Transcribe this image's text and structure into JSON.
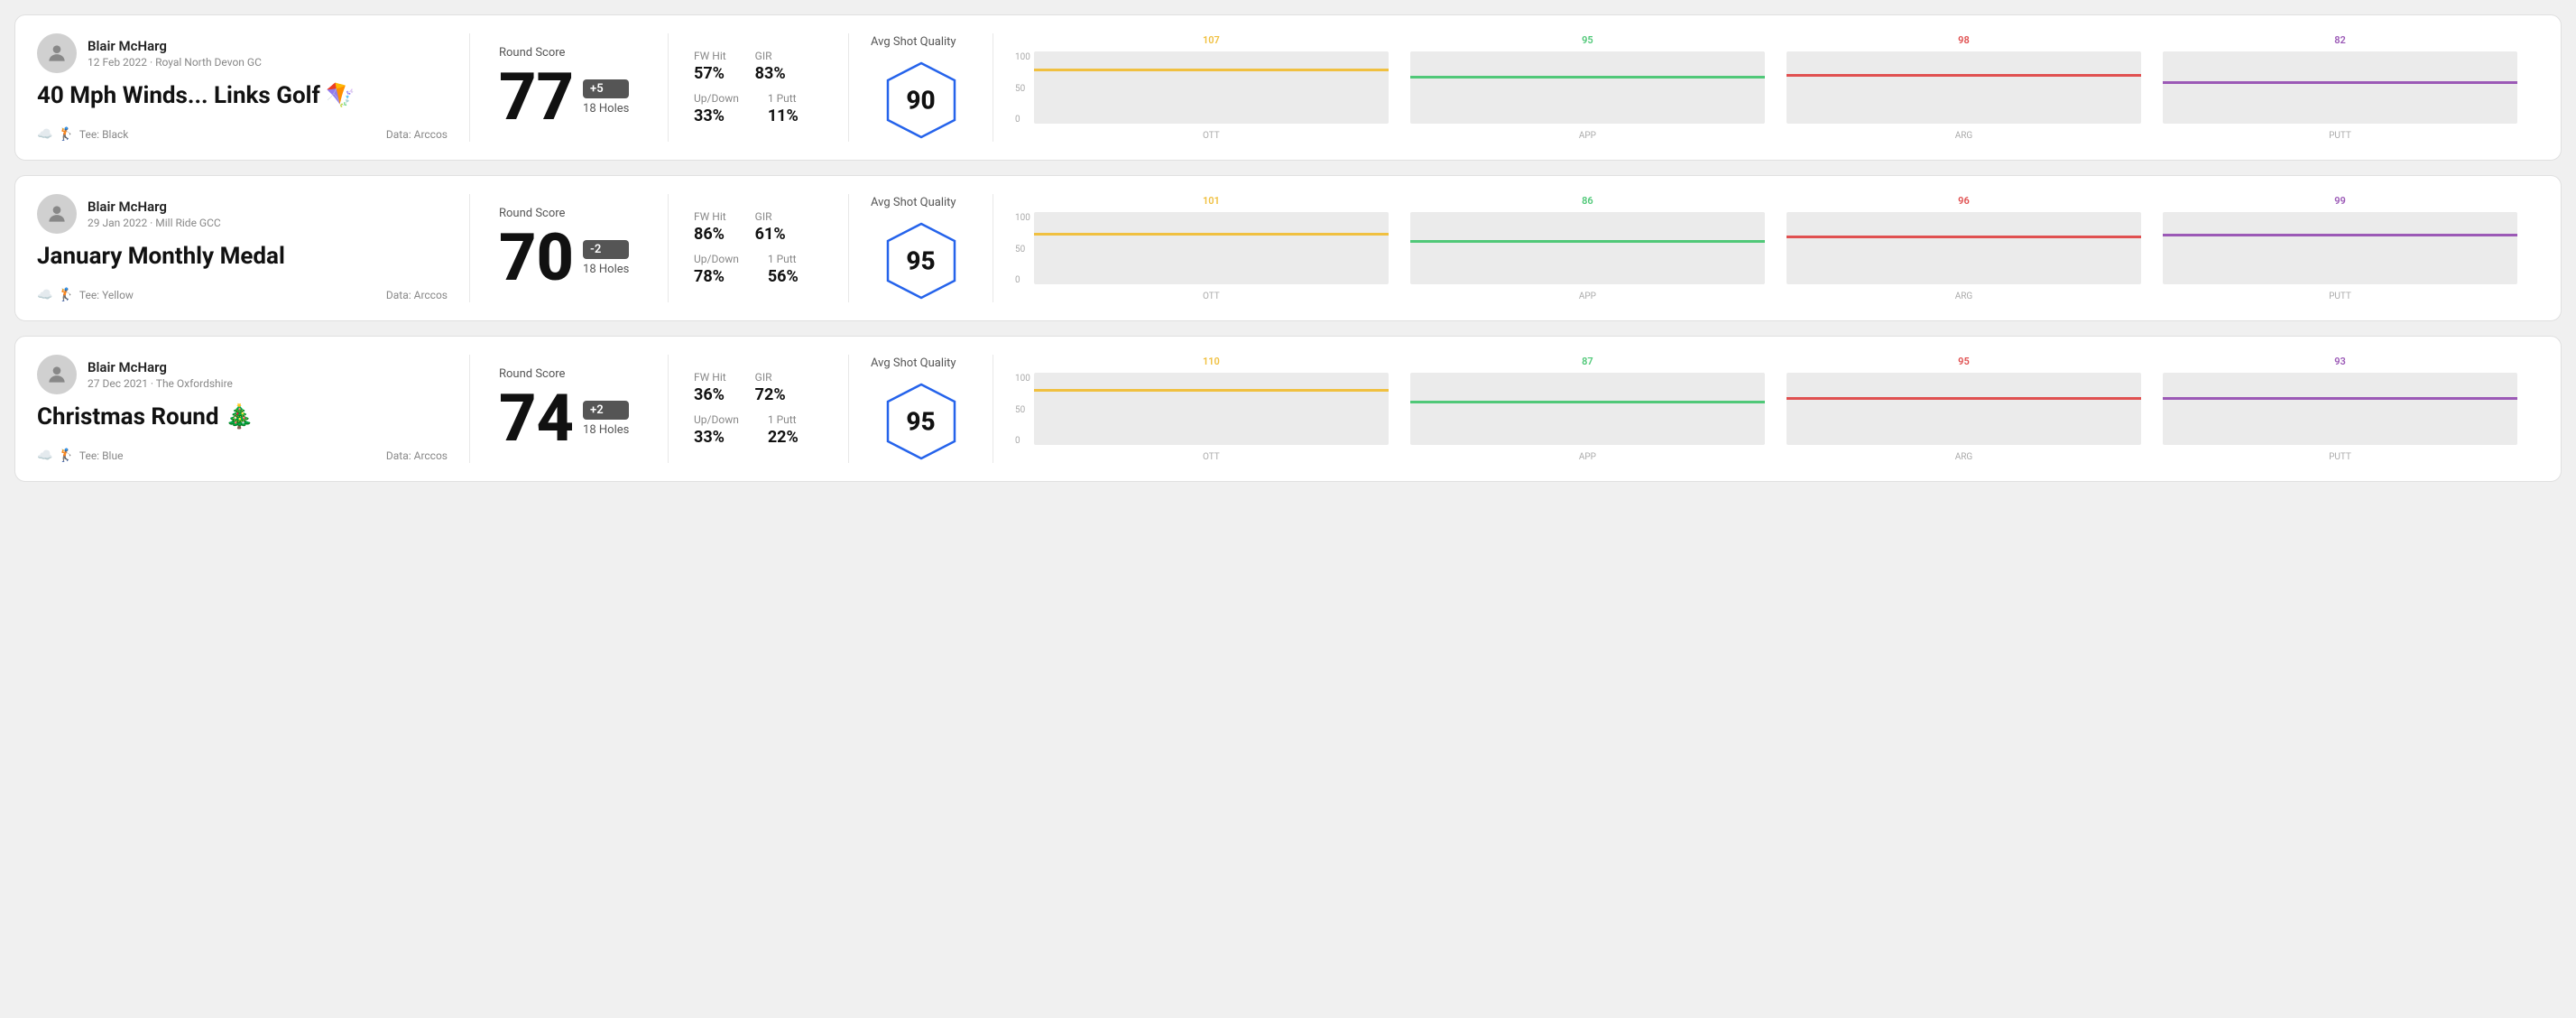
{
  "rounds": [
    {
      "id": "round1",
      "user": {
        "name": "Blair McHarg",
        "meta": "12 Feb 2022 · Royal North Devon GC"
      },
      "title": "40 Mph Winds... Links Golf 🪁",
      "tee": "Black",
      "data_source": "Arccos",
      "score": {
        "label": "Round Score",
        "number": "77",
        "modifier": "+5",
        "modifier_type": "plus",
        "holes": "18 Holes"
      },
      "stats": [
        {
          "label": "FW Hit",
          "value": "57%"
        },
        {
          "label": "GIR",
          "value": "83%"
        },
        {
          "label": "Up/Down",
          "value": "33%"
        },
        {
          "label": "1 Putt",
          "value": "11%"
        }
      ],
      "quality": {
        "label": "Avg Shot Quality",
        "score": "90"
      },
      "chart": {
        "bars": [
          {
            "label": "OTT",
            "top_value": "107",
            "color": "#f0c040",
            "fill_pct": 72
          },
          {
            "label": "APP",
            "top_value": "95",
            "color": "#50c878",
            "fill_pct": 62
          },
          {
            "label": "ARG",
            "top_value": "98",
            "color": "#e05050",
            "fill_pct": 65
          },
          {
            "label": "PUTT",
            "top_value": "82",
            "color": "#9b59b6",
            "fill_pct": 55
          }
        ]
      }
    },
    {
      "id": "round2",
      "user": {
        "name": "Blair McHarg",
        "meta": "29 Jan 2022 · Mill Ride GCC"
      },
      "title": "January Monthly Medal",
      "tee": "Yellow",
      "data_source": "Arccos",
      "score": {
        "label": "Round Score",
        "number": "70",
        "modifier": "-2",
        "modifier_type": "minus",
        "holes": "18 Holes"
      },
      "stats": [
        {
          "label": "FW Hit",
          "value": "86%"
        },
        {
          "label": "GIR",
          "value": "61%"
        },
        {
          "label": "Up/Down",
          "value": "78%"
        },
        {
          "label": "1 Putt",
          "value": "56%"
        }
      ],
      "quality": {
        "label": "Avg Shot Quality",
        "score": "95"
      },
      "chart": {
        "bars": [
          {
            "label": "OTT",
            "top_value": "101",
            "color": "#f0c040",
            "fill_pct": 68
          },
          {
            "label": "APP",
            "top_value": "86",
            "color": "#50c878",
            "fill_pct": 58
          },
          {
            "label": "ARG",
            "top_value": "96",
            "color": "#e05050",
            "fill_pct": 64
          },
          {
            "label": "PUTT",
            "top_value": "99",
            "color": "#9b59b6",
            "fill_pct": 66
          }
        ]
      }
    },
    {
      "id": "round3",
      "user": {
        "name": "Blair McHarg",
        "meta": "27 Dec 2021 · The Oxfordshire"
      },
      "title": "Christmas Round 🎄",
      "tee": "Blue",
      "data_source": "Arccos",
      "score": {
        "label": "Round Score",
        "number": "74",
        "modifier": "+2",
        "modifier_type": "plus",
        "holes": "18 Holes"
      },
      "stats": [
        {
          "label": "FW Hit",
          "value": "36%"
        },
        {
          "label": "GIR",
          "value": "72%"
        },
        {
          "label": "Up/Down",
          "value": "33%"
        },
        {
          "label": "1 Putt",
          "value": "22%"
        }
      ],
      "quality": {
        "label": "Avg Shot Quality",
        "score": "95"
      },
      "chart": {
        "bars": [
          {
            "label": "OTT",
            "top_value": "110",
            "color": "#f0c040",
            "fill_pct": 74
          },
          {
            "label": "APP",
            "top_value": "87",
            "color": "#50c878",
            "fill_pct": 58
          },
          {
            "label": "ARG",
            "top_value": "95",
            "color": "#e05050",
            "fill_pct": 63
          },
          {
            "label": "PUTT",
            "top_value": "93",
            "color": "#9b59b6",
            "fill_pct": 62
          }
        ]
      }
    }
  ],
  "y_axis_labels": [
    "100",
    "50",
    "0"
  ]
}
